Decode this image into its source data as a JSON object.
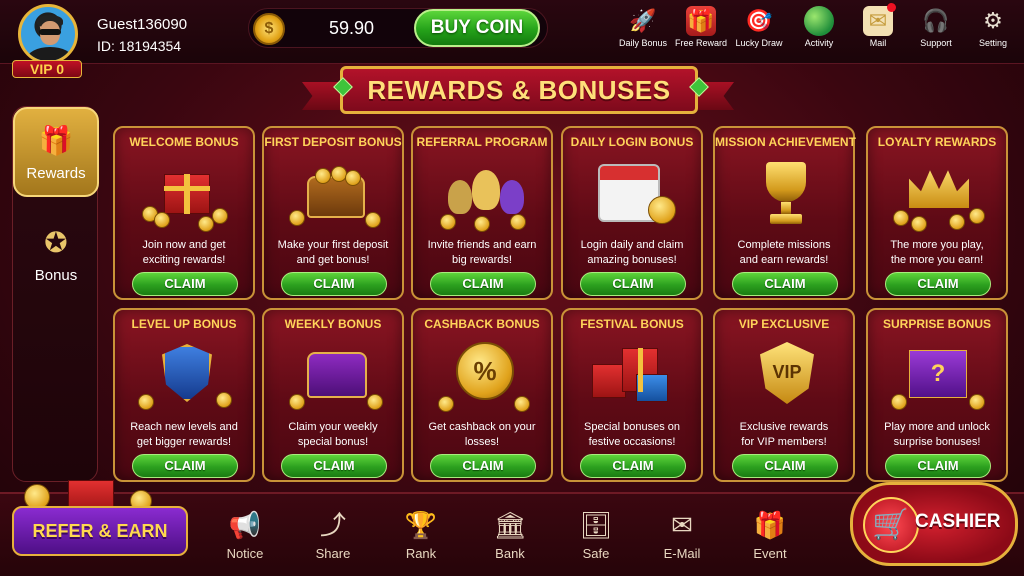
{
  "user": {
    "name": "Guest136090",
    "id_label": "ID: 18194354",
    "vip_label": "VIP 0"
  },
  "wallet": {
    "balance": "59.90",
    "buy_label": "BUY COIN"
  },
  "top_icons": [
    {
      "label": "Daily Bonus",
      "icon": "rocket-icon",
      "glyph": "🚀"
    },
    {
      "label": "Free Reward",
      "icon": "gift-icon",
      "glyph": "🎁"
    },
    {
      "label": "Lucky Draw",
      "icon": "lucky-draw-icon",
      "glyph": "🎯"
    },
    {
      "label": "Activity",
      "icon": "globe-icon",
      "glyph": ""
    },
    {
      "label": "Mail",
      "icon": "mail-icon",
      "glyph": "✉"
    },
    {
      "label": "Support",
      "icon": "headset-icon",
      "glyph": "🎧"
    },
    {
      "label": "Setting",
      "icon": "gear-icon",
      "glyph": "⚙"
    }
  ],
  "banner": {
    "title": "REWARDS & BONUSES"
  },
  "sidebar": {
    "items": [
      {
        "label": "Rewards",
        "icon": "gift-icon",
        "glyph": "🎁",
        "active": true
      },
      {
        "label": "Bonus",
        "icon": "star-badge-icon",
        "glyph": "✪",
        "active": false
      }
    ]
  },
  "cards": [
    {
      "title": "WELCOME BONUS",
      "desc_1": "Join now and get",
      "desc_2": "exciting rewards!",
      "claim": "CLAIM",
      "art": "gift"
    },
    {
      "title": "FIRST DEPOSIT BONUS",
      "desc_1": "Make your first deposit",
      "desc_2": "and get bonus!",
      "claim": "CLAIM",
      "art": "chest"
    },
    {
      "title": "REFERRAL PROGRAM",
      "desc_1": "Invite friends and earn",
      "desc_2": "big rewards!",
      "claim": "CLAIM",
      "art": "people"
    },
    {
      "title": "DAILY LOGIN BONUS",
      "desc_1": "Login daily and claim",
      "desc_2": "amazing bonuses!",
      "claim": "CLAIM",
      "art": "calendar"
    },
    {
      "title": "MISSION ACHIEVEMENT",
      "desc_1": "Complete missions",
      "desc_2": "and earn rewards!",
      "claim": "CLAIM",
      "art": "trophy"
    },
    {
      "title": "LOYALTY REWARDS",
      "desc_1": "The more you play,",
      "desc_2": "the more you earn!",
      "claim": "CLAIM",
      "art": "crown"
    },
    {
      "title": "LEVEL UP BONUS",
      "desc_1": "Reach new levels and",
      "desc_2": "get bigger rewards!",
      "claim": "CLAIM",
      "art": "shield"
    },
    {
      "title": "WEEKLY BONUS",
      "desc_1": "Claim your weekly",
      "desc_2": "special bonus!",
      "claim": "CLAIM",
      "art": "purple-chest"
    },
    {
      "title": "CASHBACK BONUS",
      "desc_1": "Get cashback on your",
      "desc_2": "losses!",
      "claim": "CLAIM",
      "art": "cashback"
    },
    {
      "title": "FESTIVAL BONUS",
      "desc_1": "Special bonuses on",
      "desc_2": "festive occasions!",
      "claim": "CLAIM",
      "art": "gifts"
    },
    {
      "title": "VIP EXCLUSIVE",
      "desc_1": "Exclusive rewards",
      "desc_2": "for VIP members!",
      "claim": "CLAIM",
      "art": "vip",
      "art_text": "VIP"
    },
    {
      "title": "SURPRISE BONUS",
      "desc_1": "Play more and unlock",
      "desc_2": "surprise bonuses!",
      "claim": "CLAIM",
      "art": "surprise"
    }
  ],
  "refer": {
    "label": "REFER & EARN"
  },
  "bottom_nav": [
    {
      "label": "Notice",
      "icon": "megaphone-icon",
      "glyph": "📢"
    },
    {
      "label": "Share",
      "icon": "share-icon",
      "glyph": "⤴"
    },
    {
      "label": "Rank",
      "icon": "trophy-icon",
      "glyph": "🏆"
    },
    {
      "label": "Bank",
      "icon": "bank-icon",
      "glyph": "🏛"
    },
    {
      "label": "Safe",
      "icon": "safe-icon",
      "glyph": "🗄"
    },
    {
      "label": "E-Mail",
      "icon": "envelope-icon",
      "glyph": "✉"
    },
    {
      "label": "Event",
      "icon": "event-gift-icon",
      "glyph": "🎁"
    }
  ],
  "cashier": {
    "label": "CASHIER"
  },
  "colors": {
    "accent_gold": "#e6b13c",
    "claim_green": "#2ca01f",
    "bg_red": "#6a0f1a"
  }
}
